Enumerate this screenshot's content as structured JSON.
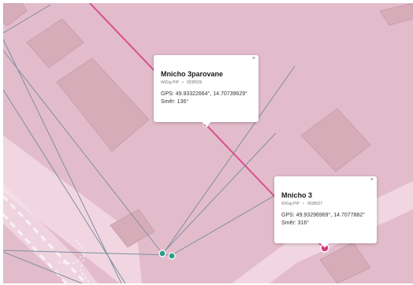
{
  "map": {
    "colors": {
      "background": "#e3bccb",
      "building_fill": "#d6acb9",
      "building_stroke": "#c99fae",
      "road_light": "#f3dbe5",
      "link_line": "#7e8f9e",
      "highlight_line": "#d9528f",
      "marker_teal": "#2f9c8c",
      "marker_pink": "#d63c7c"
    }
  },
  "popups": [
    {
      "id": "mnicho-3parovane",
      "title": "Mnicho 3parovane",
      "network": "WiGig PtP",
      "device_id": "0038526",
      "gps": "GPS: 49.93322664°, 14.70739629°",
      "direction": "Směr: 136°",
      "close_glyph": "×"
    },
    {
      "id": "mnicho-3",
      "title": "Mnicho 3",
      "network": "WiGig PtP",
      "device_id": "0038527",
      "gps": "GPS: 49.93296969°, 14.7077882°",
      "direction": "Směr: 316°",
      "close_glyph": "×"
    }
  ]
}
